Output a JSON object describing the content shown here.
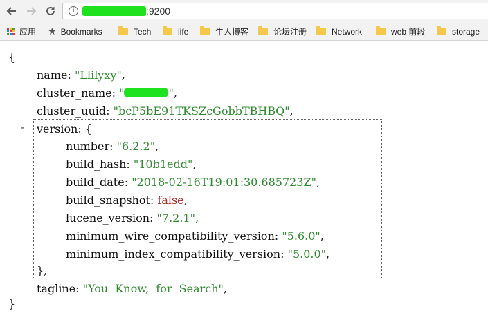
{
  "browser": {
    "back_icon": "arrow-left-icon",
    "forward_icon": "arrow-right-icon",
    "reload_icon": "reload-icon",
    "url_port": ":9200",
    "redaction_color": "#1de21d"
  },
  "bookmarks": [
    {
      "label": "应用",
      "icon": "apps-grid-icon"
    },
    {
      "label": "Bookmarks",
      "icon": "star-icon"
    },
    {
      "label": "Tech",
      "icon": "folder-icon"
    },
    {
      "label": "life",
      "icon": "folder-icon"
    },
    {
      "label": "牛人博客",
      "icon": "folder-icon"
    },
    {
      "label": "论坛注册",
      "icon": "folder-icon"
    },
    {
      "label": "Network",
      "icon": "folder-icon"
    },
    {
      "label": "web 前段",
      "icon": "folder-icon"
    },
    {
      "label": "storage",
      "icon": "folder-icon"
    }
  ],
  "json": {
    "open_brace": "{",
    "close_brace": "}",
    "name_key": "name",
    "name_val": "\"Llilyxy\"",
    "cluster_name_key": "cluster_name",
    "cluster_name_visible_suffix": "\"",
    "cluster_uuid_key": "cluster_uuid",
    "cluster_uuid_val": "\"bcP5bE91TKSZcGobbTBHBQ\"",
    "version_key": "version",
    "version_open": "{",
    "collapse_toggle": "-",
    "number_key": "number",
    "number_val": "\"6.2.2\"",
    "build_hash_key": "build_hash",
    "build_hash_val": "\"10b1edd\"",
    "build_date_key": "build_date",
    "build_date_val": "\"2018-02-16T19:01:30.685723Z\"",
    "build_snapshot_key": "build_snapshot",
    "build_snapshot_val": "false",
    "lucene_version_key": "lucene_version",
    "lucene_version_val": "\"7.2.1\"",
    "min_wire_key": "minimum_wire_compatibility_version",
    "min_wire_val": "\"5.6.0\"",
    "min_index_key": "minimum_index_compatibility_version",
    "min_index_val": "\"5.0.0\"",
    "version_close": "},",
    "tagline_key": "tagline",
    "tagline_val": "\"You  Know,  for  Search\""
  }
}
